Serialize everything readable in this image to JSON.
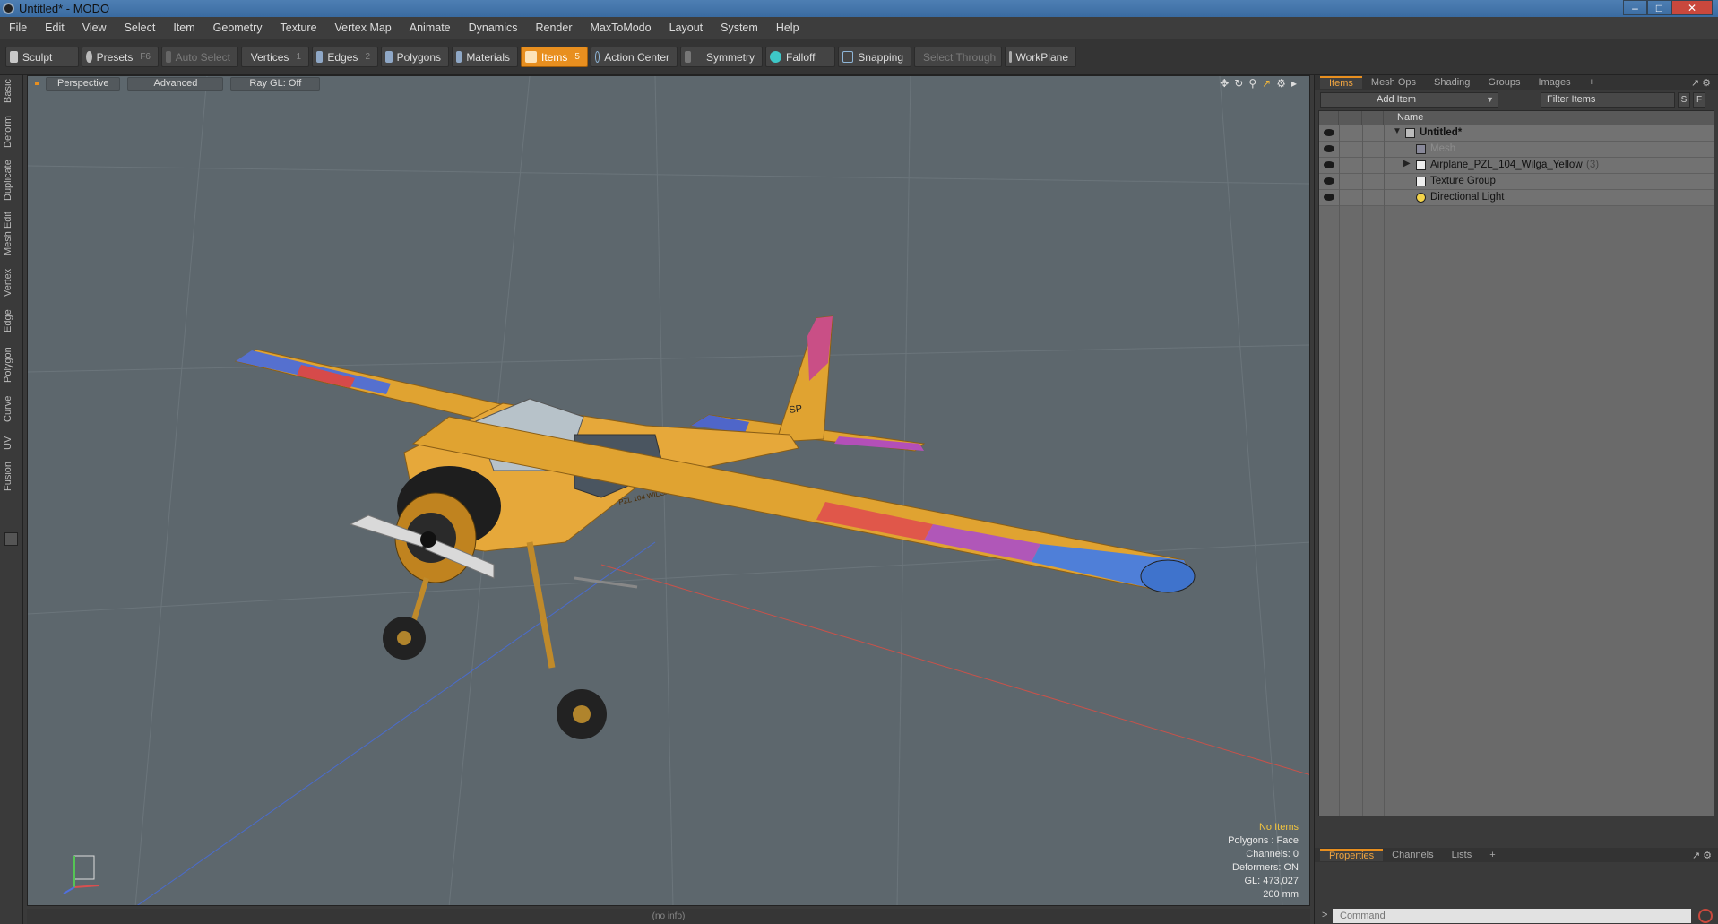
{
  "window": {
    "title": "Untitled* - MODO"
  },
  "menu": [
    "File",
    "Edit",
    "View",
    "Select",
    "Item",
    "Geometry",
    "Texture",
    "Vertex Map",
    "Animate",
    "Dynamics",
    "Render",
    "MaxToModo",
    "Layout",
    "System",
    "Help"
  ],
  "toolbar": {
    "sculpt": "Sculpt",
    "presets": "Presets",
    "presets_key": "F6",
    "auto_select": "Auto Select",
    "vertices": "Vertices",
    "vertices_key": "1",
    "edges": "Edges",
    "edges_key": "2",
    "polygons": "Polygons",
    "materials": "Materials",
    "items": "Items",
    "items_key": "5",
    "action_center": "Action Center",
    "symmetry": "Symmetry",
    "falloff": "Falloff",
    "snapping": "Snapping",
    "select_through": "Select Through",
    "workplane": "WorkPlane"
  },
  "left_tabs": [
    "Basic",
    "Deform",
    "Duplicate",
    "Mesh Edit",
    "Vertex",
    "Edge",
    "Polygon",
    "Curve",
    "UV",
    "Fusion"
  ],
  "viewport": {
    "view": "Perspective",
    "shading": "Advanced",
    "raygl": "Ray GL: Off",
    "hud": {
      "selection": "No Items",
      "polygons": "Polygons : Face",
      "channels": "Channels: 0",
      "deformers": "Deformers: ON",
      "gl": "GL: 473,027",
      "scale": "200 mm"
    },
    "model_markings": {
      "fuselage": "PZL 104 WILGA 35",
      "tail": "SP"
    }
  },
  "status": {
    "info": "(no info)"
  },
  "right_panel": {
    "tabs": [
      "Items",
      "Mesh Ops",
      "Shading",
      "Groups",
      "Images"
    ],
    "add_item": "Add Item",
    "filter": "Filter Items",
    "s": "S",
    "f": "F",
    "col_name": "Name",
    "tree": [
      {
        "label": "Untitled*",
        "count": ""
      },
      {
        "label": "Mesh",
        "count": ""
      },
      {
        "label": "Airplane_PZL_104_Wilga_Yellow",
        "count": "(3)"
      },
      {
        "label": "Texture Group",
        "count": ""
      },
      {
        "label": "Directional Light",
        "count": ""
      }
    ],
    "bottom_tabs": [
      "Properties",
      "Channels",
      "Lists"
    ],
    "command_placeholder": "Command"
  },
  "colors": {
    "accent": "#e88f1f",
    "viewport_bg": "#5d676d",
    "airplane_yellow": "#e0a331"
  }
}
